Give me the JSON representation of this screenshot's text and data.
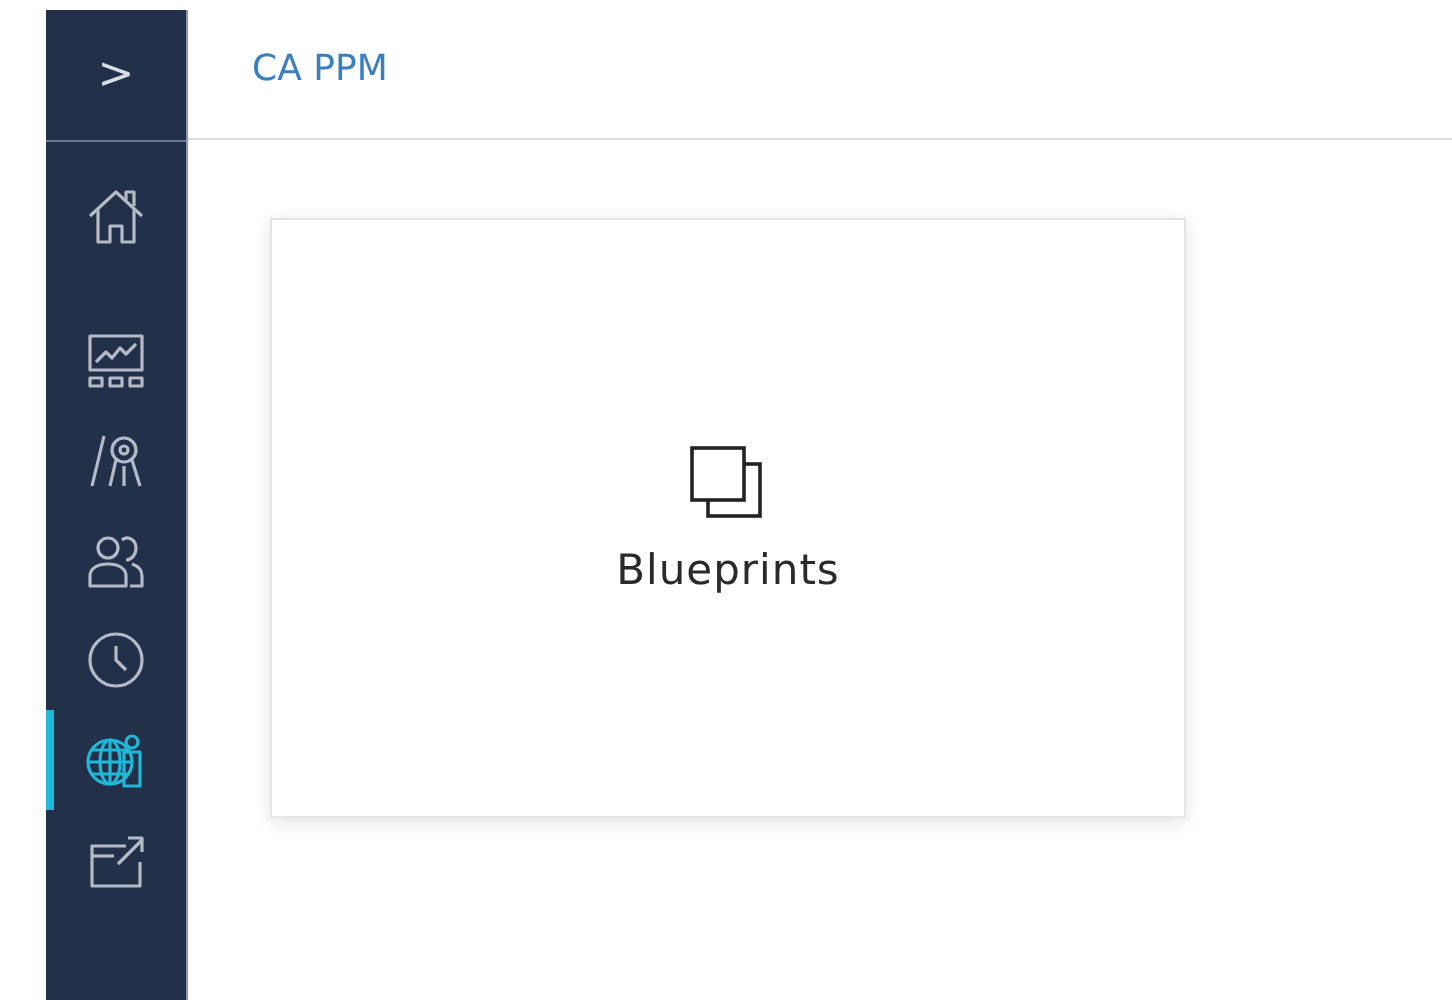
{
  "sidebar": {
    "toggle": ">",
    "items": [
      {
        "selected": false
      },
      {
        "selected": false
      },
      {
        "selected": false
      },
      {
        "selected": false
      },
      {
        "selected": false
      },
      {
        "selected": true
      },
      {
        "selected": false
      }
    ]
  },
  "header": {
    "title": "CA PPM"
  },
  "tiles": [
    {
      "label": "Blueprints"
    }
  ]
}
